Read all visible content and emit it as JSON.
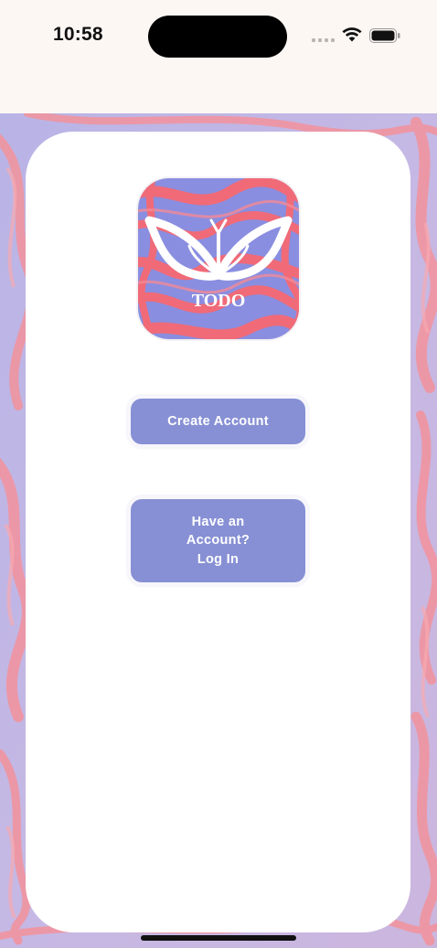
{
  "status_bar": {
    "time": "10:58",
    "icons": [
      "signal-dots-icon",
      "wifi-icon",
      "battery-icon"
    ]
  },
  "logo": {
    "icon": "butterfly-icon",
    "text": "TODO"
  },
  "buttons": {
    "create_account": "Create Account",
    "login": "Have an\nAccount?\nLog In"
  },
  "colors": {
    "button": "#8790d4",
    "marble_pink": "#f08a95",
    "marble_purple": "#a9aae2",
    "logo_pink": "#f06a78",
    "logo_purple": "#8a8ee0"
  }
}
